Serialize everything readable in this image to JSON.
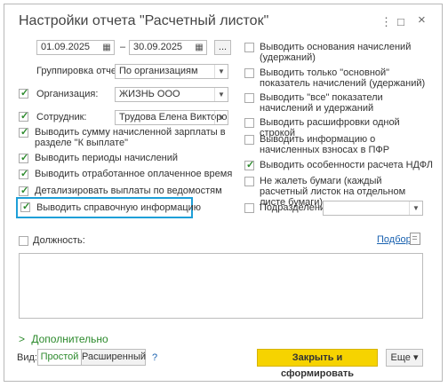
{
  "window": {
    "title": "Настройки отчета \"Расчетный листок\"",
    "menu_icon": "⋮",
    "maximize_icon": "□",
    "close_icon": "×"
  },
  "period": {
    "from": "01.09.2025",
    "dash": "–",
    "to": "30.09.2025",
    "picker_label": "..."
  },
  "grouping": {
    "label": "Группировка отчета:",
    "value": "По организациям"
  },
  "organization": {
    "label": "Организация:",
    "value": "ЖИЗНЬ ООО",
    "checked": true
  },
  "employee": {
    "label": "Сотрудник:",
    "value": "Трудова Елена Викторовн",
    "checked": true
  },
  "left_options": [
    {
      "text": "Выводить сумму начисленной зарплаты в разделе \"К выплате\"",
      "checked": true
    },
    {
      "text": "Выводить периоды начислений",
      "checked": true
    },
    {
      "text": "Выводить отработанное оплаченное время",
      "checked": true
    },
    {
      "text": "Детализировать выплаты по ведомостям",
      "checked": true
    },
    {
      "text": "Выводить справочную информацию",
      "checked": true
    }
  ],
  "right_options": [
    {
      "text": "Выводить основания начислений (удержаний)",
      "checked": false
    },
    {
      "text": "Выводить только \"основной\" показатель начислений (удержаний)",
      "checked": false
    },
    {
      "text": "Выводить \"все\" показатели начислений и удержаний",
      "checked": false
    },
    {
      "text": "Выводить расшифровки одной строкой",
      "checked": false
    },
    {
      "text": "Выводить информацию о начисленных взносах в ПФР",
      "checked": false
    },
    {
      "text": "Выводить особенности расчета НДФЛ",
      "checked": true
    },
    {
      "text": "Не жалеть бумаги (каждый расчетный листок на отдельном листе бумаги)",
      "checked": false
    }
  ],
  "subdivision": {
    "label": "Подразделение:",
    "value": "",
    "checked": false
  },
  "position": {
    "label": "Должность:",
    "checked": false,
    "select_link": "Подбор"
  },
  "more": {
    "label": "Дополнительно",
    "chevron": ">"
  },
  "view": {
    "label": "Вид:",
    "simple": "Простой",
    "extended": "Расширенный",
    "help": "?"
  },
  "buttons": {
    "close_and_build": "Закрыть и сформировать",
    "more": "Еще",
    "more_arrow": "▾"
  },
  "colors": {
    "check": "#2c8a2c",
    "highlight": "#1e9fd8",
    "primary_button": "#f6d300",
    "link": "#1a62b0"
  }
}
